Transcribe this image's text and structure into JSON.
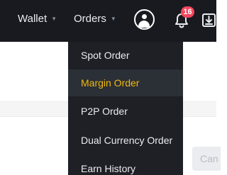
{
  "topbar": {
    "nav": [
      {
        "label": "Wallet",
        "caret": "▼"
      },
      {
        "label": "Orders",
        "caret": "▼"
      }
    ],
    "icons": [
      "user-icon",
      "bell-icon",
      "download-icon"
    ],
    "notifications_count": "16"
  },
  "orders_menu": {
    "items": [
      {
        "label": "Spot Order",
        "active": false
      },
      {
        "label": "Margin Order",
        "active": true
      },
      {
        "label": "P2P Order",
        "active": false
      },
      {
        "label": "Dual Currency Order",
        "active": false
      },
      {
        "label": "Earn History",
        "active": false
      }
    ]
  },
  "content": {
    "cancel_label": "Can"
  },
  "colors": {
    "topbar_bg": "#181a20",
    "menu_bg": "#1e2026",
    "accent": "#f0b90b",
    "badge": "#f6465d"
  }
}
